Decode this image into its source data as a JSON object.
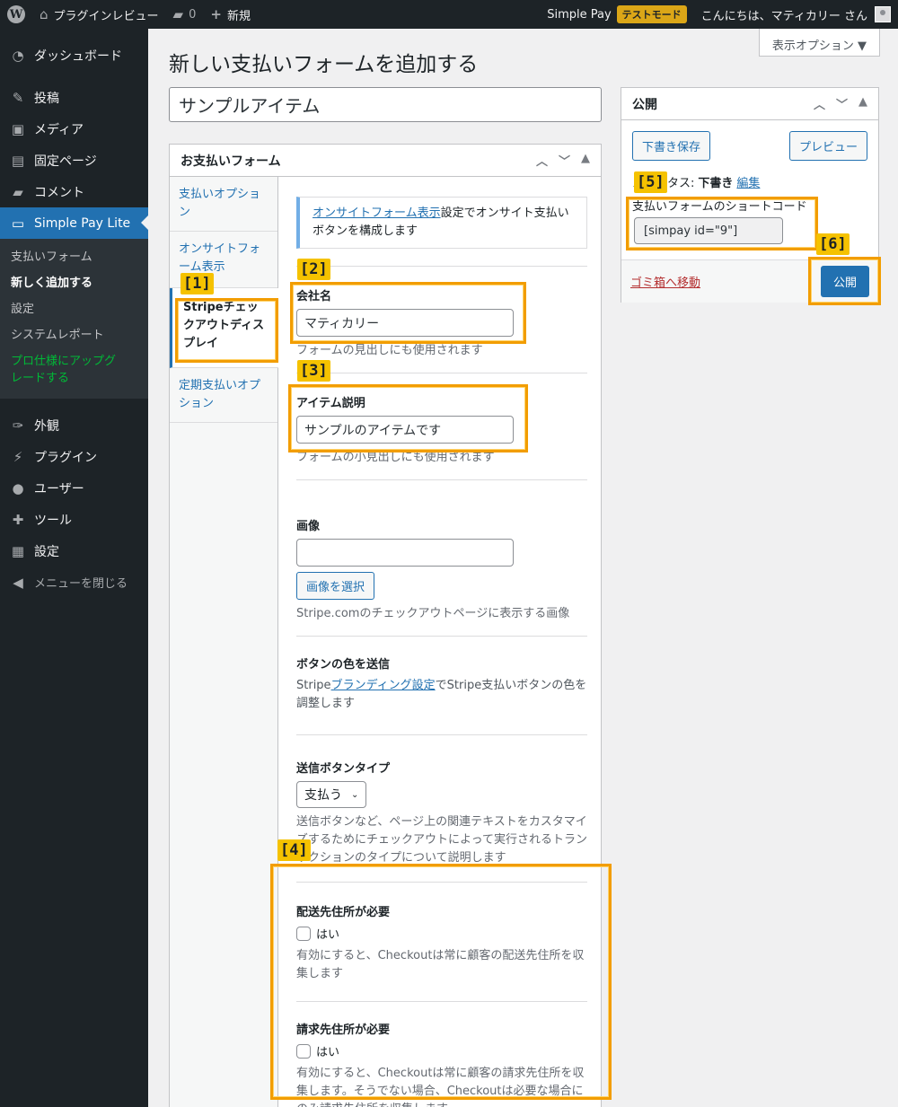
{
  "adminbar": {
    "site_name": "プラグインレビュー",
    "comments_count": "0",
    "new_label": "新規",
    "simple_pay": "Simple Pay",
    "test_mode": "テストモード",
    "greeting": "こんにちは、マティカリー さん"
  },
  "sidebar": {
    "items_top": [
      {
        "label": "ダッシュボード",
        "icon": "dashboard-icon"
      },
      {
        "label": "投稿",
        "icon": "pin-icon"
      },
      {
        "label": "メディア",
        "icon": "media-icon"
      },
      {
        "label": "固定ページ",
        "icon": "page-icon"
      },
      {
        "label": "コメント",
        "icon": "comment-icon"
      }
    ],
    "active": "Simple Pay Lite",
    "submenu": [
      "支払いフォーム",
      "新しく追加する",
      "設定",
      "システムレポート",
      "プロ仕様にアップグレードする"
    ],
    "items_bottom": [
      {
        "label": "外観",
        "icon": "brush-icon"
      },
      {
        "label": "プラグイン",
        "icon": "plugin-icon"
      },
      {
        "label": "ユーザー",
        "icon": "user-icon"
      },
      {
        "label": "ツール",
        "icon": "wrench-icon"
      },
      {
        "label": "設定",
        "icon": "settings-icon"
      }
    ],
    "collapse": "メニューを閉じる"
  },
  "header": {
    "screen_options": "表示オプション ▼",
    "page_title": "新しい支払いフォームを追加する",
    "title_value": "サンプルアイテム"
  },
  "payment_form": {
    "title": "お支払いフォーム",
    "tabs": [
      "支払いオプション",
      "オンサイトフォーム表示",
      "Stripeチェックアウトディスプレイ",
      "定期支払いオプション"
    ],
    "notice_link": "オンサイトフォーム表示",
    "notice_text": "設定でオンサイト支払いボタンを構成します",
    "company_label": "会社名",
    "company_value": "マティカリー",
    "company_desc": "フォームの見出しにも使用されます",
    "item_desc_label": "アイテム説明",
    "item_desc_value": "サンプルのアイテムです",
    "item_desc_desc": "フォームの小見出しにも使用されます",
    "image_label": "画像",
    "image_button": "画像を選択",
    "image_desc": "Stripe.comのチェックアウトページに表示する画像",
    "button_color_label": "ボタンの色を送信",
    "button_color_pre": "Stripe",
    "button_color_link": "ブランディング設定",
    "button_color_post": "でStripe支払いボタンの色を調整します",
    "submit_type_label": "送信ボタンタイプ",
    "submit_type_value": "支払う",
    "submit_type_desc": "送信ボタンなど、ページ上の関連テキストをカスタマイズするためにチェックアウトによって実行されるトランザクションのタイプについて説明します",
    "shipping_label": "配送先住所が必要",
    "shipping_check": "はい",
    "shipping_desc": "有効にすると、Checkoutは常に顧客の配送先住所を収集します",
    "billing_label": "請求先住所が必要",
    "billing_check": "はい",
    "billing_desc": "有効にすると、Checkoutは常に顧客の請求先住所を収集します。そうでない場合、Checkoutは必要な場合にのみ請求先住所を収集します"
  },
  "publish": {
    "title": "公開",
    "save_draft": "下書き保存",
    "preview": "プレビュー",
    "status_label": "ステータス:",
    "status_value": "下書き",
    "edit": "編集",
    "shortcode_label": "支払いフォームのショートコード",
    "shortcode": "[simpay id=\"9\"]",
    "trash": "ゴミ箱へ移動",
    "publish_button": "公開"
  },
  "callouts": [
    "[1]",
    "[2]",
    "[3]",
    "[4]",
    "[5]",
    "[6]"
  ],
  "colors": {
    "accent": "#2271b1",
    "callout": "#f29d00",
    "sidebar": "#1d2327"
  }
}
